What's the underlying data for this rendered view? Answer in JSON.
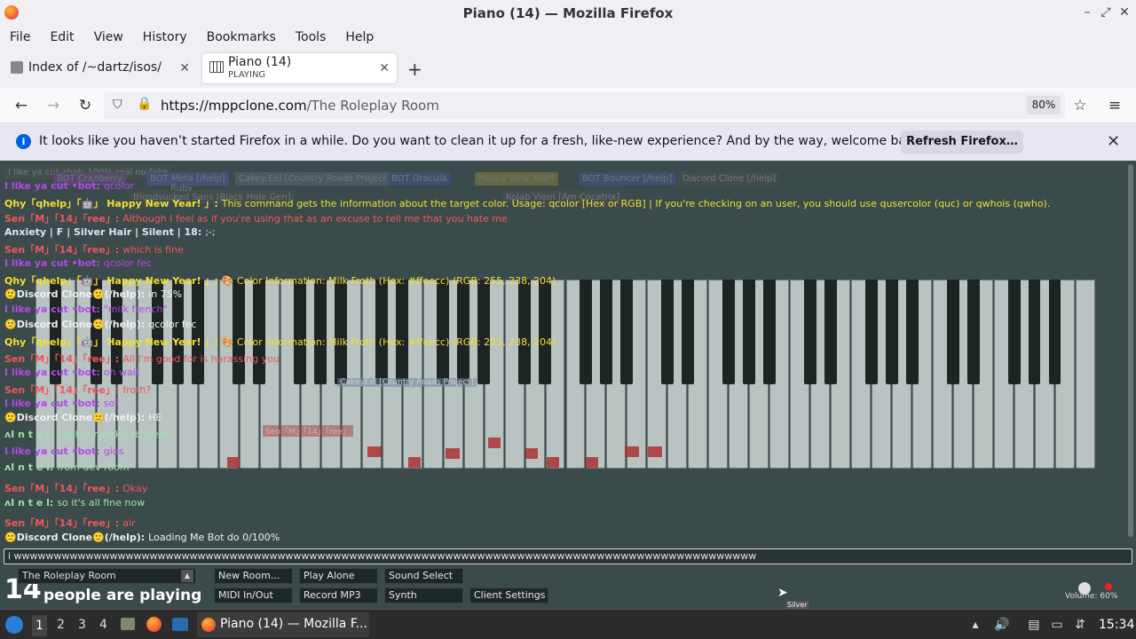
{
  "window": {
    "title": "Piano (14) — Mozilla Firefox"
  },
  "menu": [
    "File",
    "Edit",
    "View",
    "History",
    "Bookmarks",
    "Tools",
    "Help"
  ],
  "tabs": [
    {
      "title": "Index of /~dartz/isos/",
      "sub": ""
    },
    {
      "title": "Piano (14)",
      "sub": "PLAYING"
    }
  ],
  "nav": {
    "url_host": "https://mppclone.com",
    "url_path": "/The Roleplay Room",
    "zoom": "80%"
  },
  "notice": {
    "message": "It looks like you haven’t started Firefox in a while. Do you want to clean it up for a fresh, like-new experience? And by the way, welcome back!",
    "button": "Refresh Firefox…"
  },
  "ghost_users": [
    "I like ya cut •bot: 100% real no fake",
    "BOT Cranberry",
    "BOT Meta [/help]",
    "Cakey:Eel [Country Roads Project]",
    "BOT Dracula",
    "Happy New Year!",
    "BOT Bouncer [/help]",
    "Discord Clone [/help]",
    "Ruby",
    "Bloodsucked Sans [Black Hole Gen]",
    "Kolab Viem [Am Cocatrix]"
  ],
  "chat": [
    {
      "name": "I like ya cut •bot:",
      "text": "qcolor",
      "nameColor": "#b04be6",
      "textColor": "#b04be6"
    },
    {
      "name": "Qhy「qhelp」「🤖」 Happy New Year! 」:",
      "text": "This command gets the information about the target color. Usage: qcolor [Hex or RGB] | If you're checking on an user, you should use qusercolor (quc) or qwhois (qwho).",
      "nameColor": "#f0e030",
      "textColor": "#f0e030"
    },
    {
      "name": "Sen「M」「14」「ree」:",
      "text": "Although I feel as if you're using that as an excuse to tell me that you hate me",
      "nameColor": "#f05858",
      "textColor": "#f05858"
    },
    {
      "name": "Anxiety | F | Silver Hair | Silent | 18:",
      "text": ";-;",
      "nameColor": "#dfe7f0",
      "textColor": "#dfe7f0"
    },
    {
      "name": "Sen「M」「14」「ree」:",
      "text": "which is fine",
      "nameColor": "#f05858",
      "textColor": "#f05858"
    },
    {
      "name": "I like ya cut •bot:",
      "text": "qcolor fec",
      "nameColor": "#b04be6",
      "textColor": "#b04be6"
    },
    {
      "name": "Qhy「qhelp」「🤖」 Happy New Year! 」:",
      "text": "🎨 Color Information: Milk Froth (Hex: #ffeecc) (RGB: 255, 238, 204)",
      "nameColor": "#f0e030",
      "textColor": "#f0e030"
    },
    {
      "name": "🙂Discord Clone🙂(/help):",
      "text": "in 75%",
      "nameColor": "#f0f0f0",
      "textColor": "#f0f0f0"
    },
    {
      "name": "I like ya cut •bot:",
      "text": "\"milk french\"",
      "nameColor": "#b04be6",
      "textColor": "#b04be6"
    },
    {
      "name": "🙂Discord Clone🙂(/help):",
      "text": "qcolor fec",
      "nameColor": "#f0f0f0",
      "textColor": "#f0f0f0"
    },
    {
      "name": "Qhy「qhelp」「🤖」 Happy New Year! 」:",
      "text": "🎨 Color Information: Milk Froth (Hex: #ffeecc) (RGB: 255, 238, 204)",
      "nameColor": "#f0e030",
      "textColor": "#f0e030"
    },
    {
      "name": "Sen「M」「14」「ree」:",
      "text": "All I'm good for is harassing you",
      "nameColor": "#f05858",
      "textColor": "#f05858"
    },
    {
      "name": "I like ya cut •bot:",
      "text": "oh wait",
      "nameColor": "#b04be6",
      "textColor": "#b04be6"
    },
    {
      "name": "Sen「M」「14」「ree」:",
      "text": "froth?",
      "nameColor": "#f05858",
      "textColor": "#f05858"
    },
    {
      "name": "I like ya cut •bot:",
      "text": "sof",
      "nameColor": "#b04be6",
      "textColor": "#b04be6"
    },
    {
      "name": "🙂Discord Clone🙂(/help):",
      "text": "HE",
      "nameColor": "#f0f0f0",
      "textColor": "#f0f0f0"
    },
    {
      "name": "ʌI n t e l:",
      "text": "i unbanned kolab viem",
      "nameColor": "#9fe0a8",
      "textColor": "#9fe0a8"
    },
    {
      "name": "I like ya cut •bot:",
      "text": "gids",
      "nameColor": "#b04be6",
      "textColor": "#b04be6"
    },
    {
      "name": "ʌI n t e l:",
      "text": "from dev room",
      "nameColor": "#9fe0a8",
      "textColor": "#9fe0a8"
    },
    {
      "name": "Sen「M」「14」「ree」:",
      "text": "Okay",
      "nameColor": "#f05858",
      "textColor": "#f05858"
    },
    {
      "name": "ʌI n t e l:",
      "text": "so it's all fine now",
      "nameColor": "#9fe0a8",
      "textColor": "#9fe0a8"
    },
    {
      "name": "Sen「M」「14」「ree」:",
      "text": "alr",
      "nameColor": "#f05858",
      "textColor": "#f05858"
    },
    {
      "name": "🙂Discord Clone🙂(/help):",
      "text": "Loading Me Bot do 0/100%",
      "nameColor": "#f0f0f0",
      "textColor": "#f0f0f0"
    }
  ],
  "chat_input": {
    "value": "i wwwwwwwwwwwwwwwwwwwwwwwwwwwwwwwwwwwwwwwwwwwwwwwwwwwwwwwwwwwwwwwwwwwwwwwwwwwwwwwwwwwwwwwwwwwww"
  },
  "cursors": [
    "CakeyEol [Country Roads Project]",
    "Sen「M」「14」「ree」",
    "Silver"
  ],
  "controls": {
    "count": "14",
    "count_text": "people are playing",
    "room": "The Roleplay Room",
    "buttons": [
      "New Room...",
      "Play Alone",
      "Sound Select",
      "MIDI In/Out",
      "Record MP3",
      "Synth",
      "Client Settings"
    ],
    "volume": "Volume: 60%"
  },
  "taskbar": {
    "workspaces": [
      "1",
      "2",
      "3",
      "4"
    ],
    "window": "Piano (14) — Mozilla F...",
    "clock": "15:34"
  }
}
